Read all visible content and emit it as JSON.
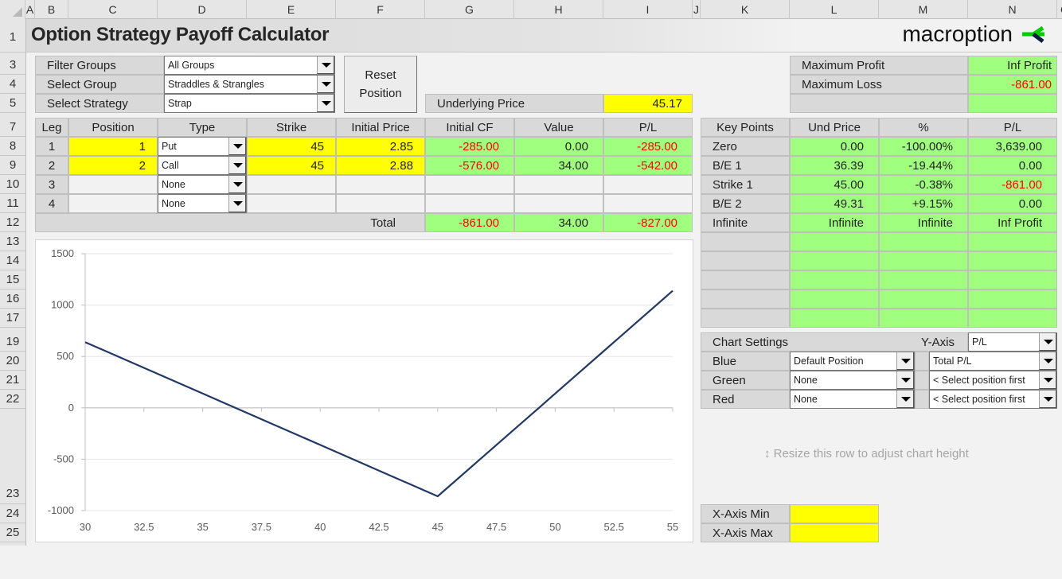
{
  "sheet": {
    "columns": [
      "A",
      "B",
      "C",
      "D",
      "E",
      "F",
      "G",
      "H",
      "I",
      "J",
      "K",
      "L",
      "M",
      "N",
      "O"
    ],
    "rows": [
      "1",
      "3",
      "4",
      "5",
      "7",
      "8",
      "9",
      "10",
      "11",
      "12",
      "13",
      "14",
      "15",
      "16",
      "17",
      "19",
      "20",
      "21",
      "22",
      "23",
      "24",
      "25"
    ]
  },
  "header": {
    "title": "Option Strategy Payoff Calculator",
    "logo_text": "macroption"
  },
  "selectors": {
    "filter_groups_label": "Filter Groups",
    "filter_groups_value": "All Groups",
    "select_group_label": "Select Group",
    "select_group_value": "Straddles & Strangles",
    "select_strategy_label": "Select Strategy",
    "select_strategy_value": "Strap",
    "reset_button_line1": "Reset",
    "reset_button_line2": "Position"
  },
  "underlying": {
    "label": "Underlying Price",
    "value": "45.17"
  },
  "summary": {
    "max_profit_label": "Maximum Profit",
    "max_profit_value": "Inf Profit",
    "max_loss_label": "Maximum Loss",
    "max_loss_value": "-861.00"
  },
  "legs_table": {
    "headers": [
      "Leg",
      "Position",
      "Type",
      "Strike",
      "Initial Price",
      "Initial CF",
      "Value",
      "P/L"
    ],
    "rows": [
      {
        "leg": "1",
        "position": "1",
        "type": "Put",
        "strike": "45",
        "initial_price": "2.85",
        "initial_cf": "-285.00",
        "value": "0.00",
        "pl": "-285.00"
      },
      {
        "leg": "2",
        "position": "2",
        "type": "Call",
        "strike": "45",
        "initial_price": "2.88",
        "initial_cf": "-576.00",
        "value": "34.00",
        "pl": "-542.00"
      },
      {
        "leg": "3",
        "position": "",
        "type": "None",
        "strike": "",
        "initial_price": "",
        "initial_cf": "",
        "value": "",
        "pl": ""
      },
      {
        "leg": "4",
        "position": "",
        "type": "None",
        "strike": "",
        "initial_price": "",
        "initial_cf": "",
        "value": "",
        "pl": ""
      }
    ],
    "total_label": "Total",
    "total_initial_cf": "-861.00",
    "total_value": "34.00",
    "total_pl": "-827.00"
  },
  "key_points": {
    "headers": [
      "Key Points",
      "Und Price",
      "%",
      "P/L"
    ],
    "rows": [
      {
        "name": "Zero",
        "und_price": "0.00",
        "pct": "-100.00%",
        "pl": "3,639.00",
        "neg": false
      },
      {
        "name": "B/E 1",
        "und_price": "36.39",
        "pct": "-19.44%",
        "pl": "0.00",
        "neg": false
      },
      {
        "name": "Strike 1",
        "und_price": "45.00",
        "pct": "-0.38%",
        "pl": "-861.00",
        "neg": true
      },
      {
        "name": "B/E 2",
        "und_price": "49.31",
        "pct": "+9.15%",
        "pl": "0.00",
        "neg": false
      },
      {
        "name": "Infinite",
        "und_price": "Infinite",
        "pct": "Infinite",
        "pl": "Inf Profit",
        "neg": false
      }
    ]
  },
  "chart_settings": {
    "title": "Chart Settings",
    "y_axis_label": "Y-Axis",
    "y_axis_value": "P/L",
    "blue_label": "Blue",
    "blue_position": "Default Position",
    "blue_series": "Total P/L",
    "green_label": "Green",
    "green_position": "None",
    "green_series": "< Select position first",
    "red_label": "Red",
    "red_position": "None",
    "red_series": "< Select position first"
  },
  "hint_text": "Resize this row to adjust chart height",
  "x_axis_settings": {
    "min_label": "X-Axis Min",
    "min_value": "",
    "max_label": "X-Axis Max",
    "max_value": ""
  },
  "colors": {
    "input_yellow": "#ffff00",
    "output_green": "#a0ff7f",
    "negative_red": "#ff0000",
    "series_blue": "#1f3864",
    "logo_green": "#00cc00",
    "logo_navy": "#0d1b3e"
  },
  "chart_data": {
    "type": "line",
    "title": "",
    "xlabel": "",
    "ylabel": "",
    "xlim": [
      30,
      55
    ],
    "ylim": [
      -1000,
      1500
    ],
    "x_ticks": [
      "30",
      "32.5",
      "35",
      "37.5",
      "40",
      "42.5",
      "45",
      "47.5",
      "50",
      "52.5",
      "55"
    ],
    "y_ticks": [
      "1500",
      "1000",
      "500",
      "0",
      "-500",
      "-1000"
    ],
    "grid": true,
    "legend": "none",
    "series": [
      {
        "name": "Total P/L",
        "color": "#1f3864",
        "x": [
          30,
          32.5,
          35,
          36.39,
          37.5,
          40,
          42.5,
          45,
          47.5,
          49.31,
          50,
          52.5,
          55
        ],
        "y": [
          639,
          389,
          139,
          0,
          -111,
          -361,
          -611,
          -861,
          -361,
          0,
          139,
          639,
          1139
        ]
      }
    ]
  }
}
